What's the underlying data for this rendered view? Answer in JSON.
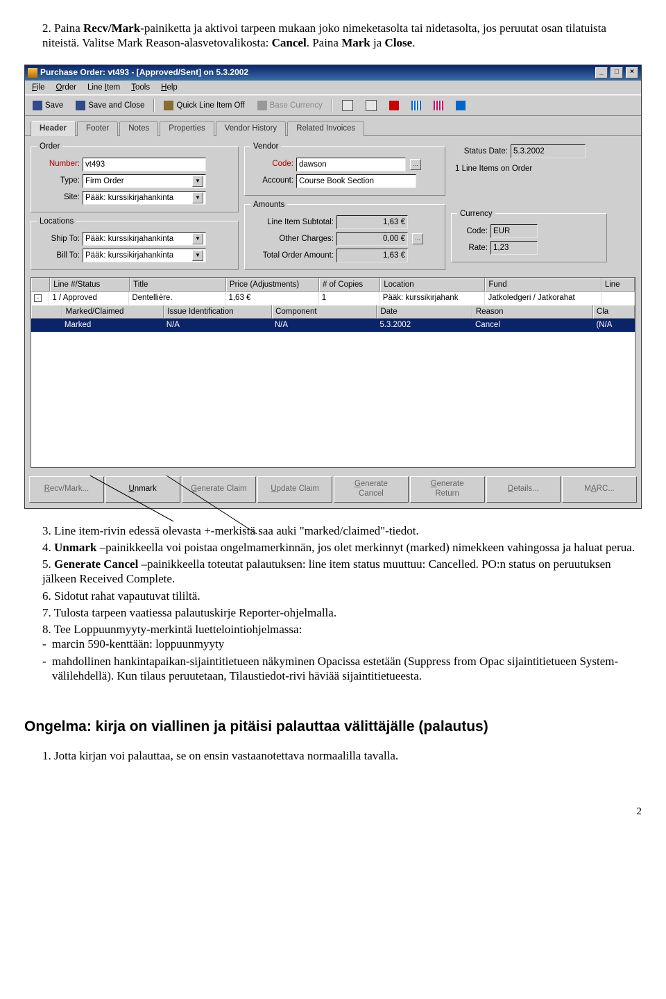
{
  "instructions_top": [
    {
      "num": "2.",
      "html": "Paina <b>Recv/Mark</b>-painiketta ja aktivoi tarpeen mukaan joko nimeketasolta tai nidetasolta, jos peruutat osan tilatuista niteistä. Valitse Mark Reason-alasvetovalikosta: <b>Cancel</b>. Paina <b>Mark</b> ja <b>Close</b>."
    }
  ],
  "window": {
    "title": "Purchase Order: vt493 - [Approved/Sent] on 5.3.2002",
    "menus": [
      "File",
      "Order",
      "Line Item",
      "Tools",
      "Help"
    ],
    "menu_underline_idx": [
      0,
      0,
      5,
      0,
      0
    ],
    "toolbar": {
      "save": "Save",
      "save_close": "Save and Close",
      "quick": "Quick Line Item Off",
      "base": "Base Currency"
    },
    "tabs": [
      "Header",
      "Footer",
      "Notes",
      "Properties",
      "Vendor History",
      "Related Invoices"
    ],
    "order": {
      "legend": "Order",
      "number_label": "Number:",
      "number": "vt493",
      "type_label": "Type:",
      "type": "Firm Order",
      "site_label": "Site:",
      "site": "Pääk: kurssikirjahankinta"
    },
    "locations": {
      "legend": "Locations",
      "ship_label": "Ship To:",
      "ship": "Pääk: kurssikirjahankinta",
      "bill_label": "Bill To:",
      "bill": "Pääk: kurssikirjahankinta"
    },
    "vendor": {
      "legend": "Vendor",
      "code_label": "Code:",
      "code": "dawson",
      "account_label": "Account:",
      "account": "Course Book Section"
    },
    "amounts": {
      "legend": "Amounts",
      "subtotal_label": "Line Item Subtotal:",
      "subtotal": "1,63 €",
      "other_label": "Other Charges:",
      "other": "0,00 €",
      "total_label": "Total Order Amount:",
      "total": "1,63 €"
    },
    "status": {
      "date_label": "Status Date:",
      "date": "5.3.2002",
      "items_text": "1 Line Items on Order"
    },
    "currency": {
      "legend": "Currency",
      "code_label": "Code:",
      "code": "EUR",
      "rate_label": "Rate:",
      "rate": "1,23"
    },
    "grid": {
      "h1": [
        "Line #/Status",
        "Title",
        "Price (Adjustments)",
        "# of Copies",
        "Location",
        "Fund",
        "Line"
      ],
      "r1": [
        "1 / Approved",
        "Dentellière.",
        "1,63 €",
        "1",
        "Pääk: kurssikirjahank",
        "Jatkoledgeri / Jatkorahat",
        ""
      ],
      "h2": [
        "Marked/Claimed",
        "Issue Identification",
        "Component",
        "Date",
        "Reason",
        "Cla"
      ],
      "r2": [
        "Marked",
        "N/A",
        "N/A",
        "5.3.2002",
        "Cancel",
        "(N/A"
      ]
    },
    "buttons": [
      "Recv/Mark...",
      "Unmark",
      "Generate Claim",
      "Update Claim",
      "Generate\nCancel",
      "Generate\nReturn",
      "Details...",
      "MARC..."
    ],
    "buttons_enabled": [
      false,
      true,
      false,
      false,
      false,
      false,
      false,
      false
    ]
  },
  "instructions_bottom": [
    {
      "num": "3.",
      "html": "Line item-rivin edessä olevasta +-merkistä saa auki \"marked/claimed\"-tiedot."
    },
    {
      "num": "4.",
      "html": "<b>Unmark</b> –painikkeella voi poistaa ongelmamerkinnän, jos olet merkinnyt (marked) nimekkeen vahingossa ja haluat perua."
    },
    {
      "num": "5.",
      "html": "<b>Generate Cancel</b> –painikkeella toteutat palautuksen: line item status muuttuu: Cancelled. PO:n status on peruutuksen jälkeen Received Complete."
    },
    {
      "num": "6.",
      "html": "Sidotut rahat vapautuvat tililtä."
    },
    {
      "num": "7.",
      "html": "Tulosta tarpeen vaatiessa palautuskirje Reporter-ohjelmalla."
    },
    {
      "num": "8.",
      "html": "Tee Loppuunmyyty-merkintä luettelointiohjelmassa:",
      "sub": [
        "marcin 590-kenttään: loppuunmyyty",
        "mahdollinen hankintapaikan-sijaintitietueen näkyminen Opacissa estetään (Suppress from Opac sijaintitietueen System-välilehdellä). Kun tilaus peruutetaan, Tilaustiedot-rivi häviää sijaintitietueesta."
      ]
    }
  ],
  "heading": "Ongelma: kirja on viallinen ja pitäisi palauttaa välittäjälle (palautus)",
  "bottom_list": [
    {
      "num": "1.",
      "html": "Jotta kirjan voi palauttaa, se on ensin vastaanotettava normaalilla tavalla."
    }
  ],
  "page_num": "2"
}
